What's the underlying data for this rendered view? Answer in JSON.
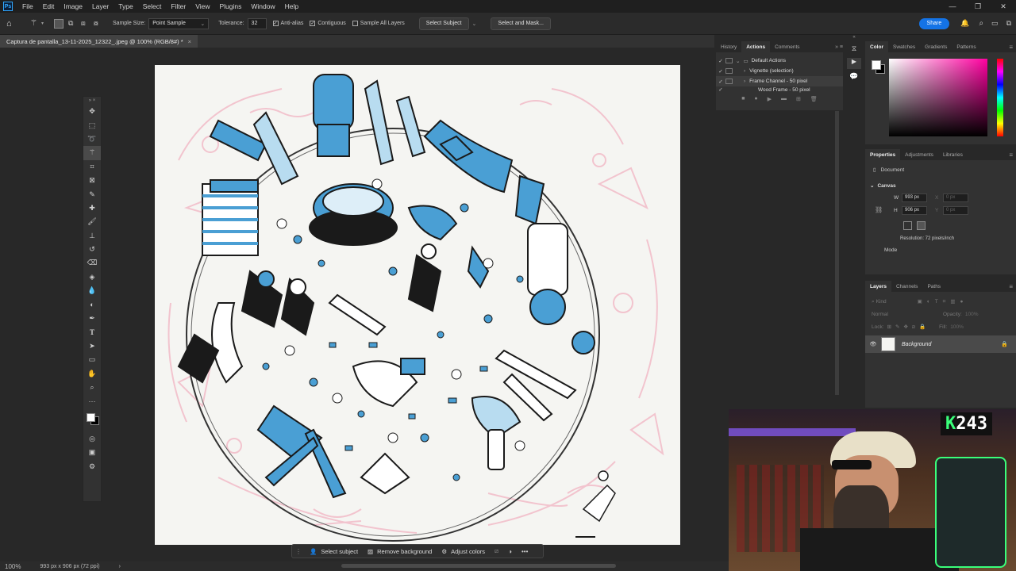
{
  "app": {
    "logo": "Ps",
    "menu": [
      "File",
      "Edit",
      "Image",
      "Layer",
      "Type",
      "Select",
      "Filter",
      "View",
      "Plugins",
      "Window",
      "Help"
    ],
    "window_controls": [
      "—",
      "❐",
      "✕"
    ]
  },
  "options_bar": {
    "sample_size_label": "Sample Size:",
    "sample_size_value": "Point Sample",
    "tolerance_label": "Tolerance:",
    "tolerance_value": "32",
    "anti_alias": "Anti-alias",
    "contiguous": "Contiguous",
    "sample_all_layers": "Sample All Layers",
    "select_subject": "Select Subject",
    "select_and_mask": "Select and Mask...",
    "share": "Share"
  },
  "document": {
    "tab_title": "Captura de pantalla_13-11-2025_12322_.jpeg @ 100% (RGB/8#) *",
    "close": "×",
    "zoom": "100%",
    "status_info": "993 px x 906 px (72 ppi)"
  },
  "contextual_taskbar": {
    "select_subject": "Select subject",
    "remove_background": "Remove background",
    "adjust_colors": "Adjust colors",
    "more": "•••"
  },
  "actions_panel": {
    "tabs": [
      "History",
      "Actions",
      "Comments"
    ],
    "active_tab": "Actions",
    "items": [
      {
        "label": "Default Actions",
        "type": "set"
      },
      {
        "label": "Vignette (selection)",
        "type": "action"
      },
      {
        "label": "Frame Channel - 50 pixel",
        "type": "action"
      },
      {
        "label": "Wood Frame - 50 pixel",
        "type": "action"
      }
    ]
  },
  "color_panel": {
    "tabs": [
      "Color",
      "Swatches",
      "Gradients",
      "Patterns"
    ],
    "active_tab": "Color",
    "hue": "#ff00a0"
  },
  "properties_panel": {
    "tabs": [
      "Properties",
      "Adjustments",
      "Libraries"
    ],
    "active_tab": "Properties",
    "document_label": "Document",
    "canvas_section": "Canvas",
    "w_label": "W",
    "w_value": "993 px",
    "h_label": "H",
    "h_value": "906 px",
    "x_label": "X",
    "x_value": "0 px",
    "y_label": "Y",
    "y_value": "0 px",
    "resolution": "Resolution: 72 pixels/inch",
    "mode_label": "Mode"
  },
  "layers_panel": {
    "tabs": [
      "Layers",
      "Channels",
      "Paths"
    ],
    "active_tab": "Layers",
    "kind_placeholder": "Kind",
    "blend_mode": "Normal",
    "opacity_label": "Opacity:",
    "opacity_value": "100%",
    "lock_label": "Lock:",
    "fill_label": "Fill:",
    "fill_value": "100%",
    "layers": [
      {
        "name": "Background",
        "visible": true,
        "locked": true
      }
    ]
  },
  "webcam_overlay": {
    "badge_prefix": "K",
    "badge_value": "243"
  },
  "colors": {
    "accent": "#1473e6",
    "illustration_blue": "#4a9fd4",
    "illustration_pink": "#f2b8c6"
  }
}
